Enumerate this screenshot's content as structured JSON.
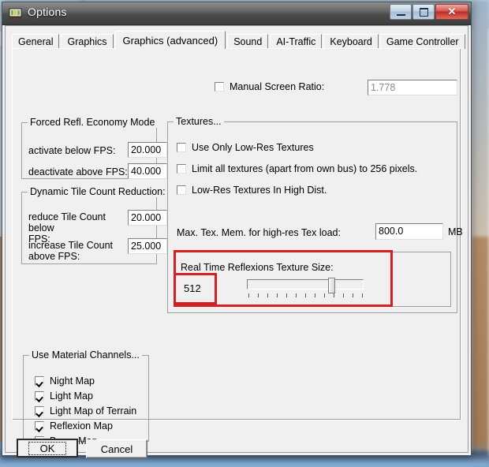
{
  "window": {
    "title": "Options",
    "icon": "options-app-icon",
    "buttons": {
      "minimize": "minimize-button",
      "maximize": "maximize-button",
      "close_label": "✕"
    }
  },
  "tabs": [
    {
      "label": "General",
      "active": false
    },
    {
      "label": "Graphics",
      "active": false
    },
    {
      "label": "Graphics (advanced)",
      "active": true
    },
    {
      "label": "Sound",
      "active": false
    },
    {
      "label": "AI-Traffic",
      "active": false
    },
    {
      "label": "Keyboard",
      "active": false
    },
    {
      "label": "Game Controller",
      "active": false
    }
  ],
  "manual_screen_ratio": {
    "label": "Manual Screen Ratio:",
    "checked": false,
    "value": "1.778"
  },
  "forced_refl": {
    "title": "Forced Refl. Economy Mode",
    "rows": [
      {
        "label": "activate below FPS:",
        "value": "20.000"
      },
      {
        "label": "deactivate above FPS:",
        "value": "40.000"
      }
    ]
  },
  "dynamic_tile": {
    "title": "Dynamic Tile Count Reduction:",
    "rows": [
      {
        "label_line1": "reduce Tile Count below",
        "label_line2": "FPS:",
        "value": "20.000"
      },
      {
        "label_line1": "increase Tile Count",
        "label_line2": "above FPS:",
        "value": "25.000"
      }
    ]
  },
  "textures": {
    "title": "Textures...",
    "checkboxes": [
      {
        "label": "Use Only Low-Res Textures",
        "checked": false
      },
      {
        "label": "Limit all textures (apart from own bus) to 256 pixels.",
        "checked": false
      },
      {
        "label": "Low-Res Textures In High Dist.",
        "checked": false
      }
    ],
    "max_tex_mem": {
      "label": "Max. Tex. Mem. for high-res Tex load:",
      "value": "800.0",
      "unit": "MB"
    },
    "reflexion": {
      "label": "Real Time Reflexions Texture Size:",
      "value": "512",
      "slider": {
        "ticks": 13,
        "thumb_position_percent": 70
      }
    }
  },
  "material_channels": {
    "title": "Use Material Channels...",
    "checkboxes": [
      {
        "label": "Night Map",
        "checked": true
      },
      {
        "label": "Light Map",
        "checked": true
      },
      {
        "label": "Light Map of Terrain",
        "checked": true
      },
      {
        "label": "Reflexion Map",
        "checked": true
      },
      {
        "label": "Bump Map",
        "checked": true
      }
    ]
  },
  "footer": {
    "ok_label": "OK",
    "cancel_label": "Cancel"
  },
  "annotations": {
    "highlight_color": "#d81f1f",
    "boxes": [
      {
        "name": "reflexion-value-highlight"
      },
      {
        "name": "reflexion-section-highlight"
      }
    ]
  }
}
